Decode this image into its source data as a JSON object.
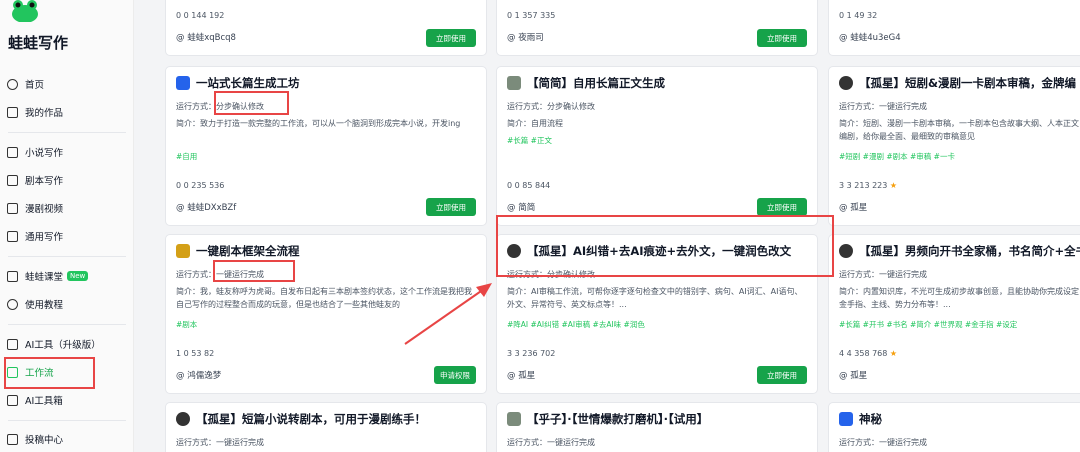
{
  "brand": "蛙蛙写作",
  "nav": [
    {
      "label": "首页"
    },
    {
      "label": "我的作品"
    },
    {
      "label": "小说写作"
    },
    {
      "label": "剧本写作"
    },
    {
      "label": "漫剧视频"
    },
    {
      "label": "通用写作"
    },
    {
      "label": "蛙蛙课堂",
      "badge": "New"
    },
    {
      "label": "使用教程"
    },
    {
      "label": "AI工具（升级版）"
    },
    {
      "label": "工作流"
    },
    {
      "label": "AI工具箱"
    },
    {
      "label": "投稿中心"
    }
  ],
  "row0": [
    {
      "stats": "0 0 144 192",
      "author": "@ 蛙蛙xqBcq8",
      "btn": "立即使用"
    },
    {
      "stats": "0 1 357 335",
      "author": "@ 夜雨司",
      "btn": "立即使用"
    },
    {
      "stats": "0 1 49 32",
      "author": "@ 蛙蛙4u3eG4"
    }
  ],
  "row1": [
    {
      "title": "一站式长篇生成工坊",
      "mode": "运行方式：分步确认修改",
      "desc": "简介：致力于打造一款完整的工作流，可以从一个脑洞到形成完本小说，开发ing",
      "tags": "#自用",
      "stats": "0 0 235 536",
      "author": "@ 蛙蛙DXxBZf",
      "btn": "立即使用"
    },
    {
      "title": "【简简】自用长篇正文生成",
      "mode": "运行方式：分步确认修改",
      "desc": "简介：自用流程",
      "tags": "#长篇 #正文",
      "stats": "0 0 85 844",
      "author": "@ 简简",
      "btn": "立即使用"
    },
    {
      "title": "【孤星】短剧&漫剧一卡剧本审稿，金牌编",
      "mode": "运行方式：一键运行完成",
      "desc": "简介：短剧、漫剧一卡剧本审稿，一卡剧本包含故事大纲、人本正文，统统交给金牌编剧，给你最全面、最细致的审稿意见",
      "tags": "#短剧 #漫剧 #剧本 #审稿 #一卡",
      "stats": "3 3 213 223",
      "author": "@ 孤星"
    }
  ],
  "row2": [
    {
      "title": "一键剧本框架全流程",
      "mode": "运行方式：一键运行完成",
      "desc": "简介：我，蛙友称呼为虎哥。自发布日起有三本剧本签约状态，这个工作流是我把我自己写作的过程整合而成的玩意，但是也结合了一些其他蛙友的",
      "tags": "#剧本",
      "stats": "1 0 53 82",
      "author": "@ 鸿儒逸梦",
      "btn": "申请权限"
    },
    {
      "title": "【孤星】AI纠错+去AI痕迹+去外文，一键润色改文",
      "mode": "运行方式：分步确认修改",
      "desc": "简介：AI审稿工作流，可帮你逐字逐句检查文中的错别字、病句、AI词汇、AI语句、外文、异常符号、英文标点等！...",
      "tags": "#降AI #AI纠错 #AI审稿 #去AI味 #润色",
      "stats": "3 3 236 702",
      "author": "@ 孤星",
      "btn": "立即使用"
    },
    {
      "title": "【孤星】男频向开书全家桶，书名简介+全书",
      "mode": "运行方式：一键运行完成",
      "desc": "简介：内置知识库，不光可生成初步故事创意，且能协助你完成设定，包括世界观、金手指、主线、势力分布等！...",
      "tags": "#长篇 #开书 #书名 #简介 #世界观 #金手指 #设定",
      "stats": "4 4 358 768",
      "author": "@ 孤星"
    }
  ],
  "row3": [
    {
      "title": "【孤星】短篇小说转剧本，可用于漫剧练手！",
      "mode": "运行方式：一键运行完成"
    },
    {
      "title": "【乎子】·【世情爆款打磨机】·【试用】",
      "mode": "运行方式：一键运行完成"
    },
    {
      "title": "神秘",
      "mode": "运行方式：一键运行完成"
    }
  ]
}
